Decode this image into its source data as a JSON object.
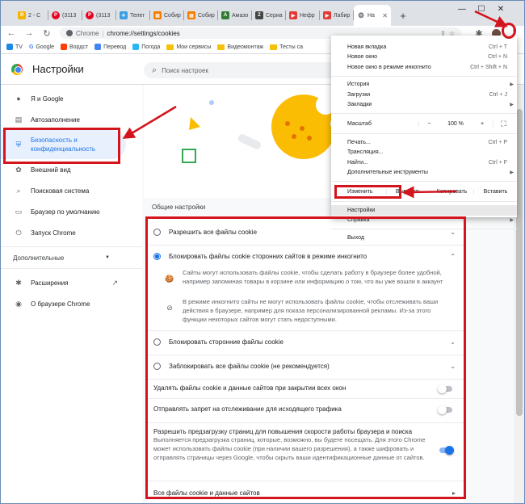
{
  "tabs": [
    {
      "label": "2 - С",
      "color": "#f4b400",
      "glyph": "Я"
    },
    {
      "label": "(3113",
      "color": "#e60023",
      "glyph": "P"
    },
    {
      "label": "(3113",
      "color": "#e60023",
      "glyph": "P"
    },
    {
      "label": "Телег",
      "color": "#3d9ee0",
      "glyph": "✈"
    },
    {
      "label": "Собир",
      "color": "#f57c00",
      "glyph": "▤"
    },
    {
      "label": "Собир",
      "color": "#f57c00",
      "glyph": "▤"
    },
    {
      "label": "Амазо",
      "color": "#2e7d32",
      "glyph": "A"
    },
    {
      "label": "Сериа",
      "color": "#444",
      "glyph": "Z"
    },
    {
      "label": "Нефр",
      "color": "#e53935",
      "glyph": "▶"
    },
    {
      "label": "Лабир",
      "color": "#e53935",
      "glyph": "▶"
    },
    {
      "label": "На",
      "color": "#5f6368",
      "glyph": "⚙"
    }
  ],
  "address": {
    "site": "Chrome",
    "url": "chrome://settings/cookies"
  },
  "bookmarks": [
    "TV",
    "Google",
    "Вордст",
    "Перевод",
    "Погода",
    "Мои сервисы",
    "Видеомонтаж",
    "Тесты са"
  ],
  "header": {
    "title": "Настройки",
    "search_placeholder": "Поиск настроек"
  },
  "sidebar": {
    "items": [
      {
        "label": "Я и Google",
        "icon": "person-icon",
        "glyph": "👤"
      },
      {
        "label": "Автозаполнение",
        "icon": "document-icon",
        "glyph": "▤"
      },
      {
        "label": "Безопасность и конфиденциальность",
        "icon": "shield-icon",
        "glyph": "⛨"
      },
      {
        "label": "Внешний вид",
        "icon": "palette-icon",
        "glyph": "🎨"
      },
      {
        "label": "Поисковая система",
        "icon": "search-icon",
        "glyph": "⌕"
      },
      {
        "label": "Браузер по умолчанию",
        "icon": "browser-icon",
        "glyph": "▭"
      },
      {
        "label": "Запуск Chrome",
        "icon": "power-icon",
        "glyph": "⏻"
      }
    ],
    "advanced": "Дополнительные",
    "extensions": "Расширения",
    "about": "О браузере Chrome"
  },
  "main": {
    "section_title": "Общие настройки",
    "options": [
      "Разрешить все файлы cookie",
      "Блокировать файлы cookie сторонних сайтов в режиме инкогнито",
      "Блокировать сторонние файлы cookie",
      "Заблокировать все файлы cookie (не рекомендуется)"
    ],
    "desc1": "Сайты могут использовать файлы cookie, чтобы сделать работу в браузере более удобной, например запоминая товары в корзине или информацию о том, что вы уже вошли в аккаунт",
    "desc2": "В режиме инкогнито сайты не могут использовать файлы cookie, чтобы отслеживать ваши действия в браузере, например для показа персонализированной рекламы. Из-за этого функции некоторых сайтов могут стать недоступными.",
    "toggle1": "Удалять файлы cookie и данные сайтов при закрытии всех окон",
    "toggle2": "Отправлять запрет на отслеживание для исходящего трафика",
    "toggle3_title": "Разрешить предзагрузку страниц для повышения скорости работы браузера и поиска",
    "toggle3_desc": "Выполняется предзагрузка страниц, которые, возможно, вы будете посещать. Для этого Chrome может использовать файлы cookie (при наличии вашего разрешения), а также шифровать и отправлять страницы через Google, чтобы скрыть ваши идентификационные данные от сайтов.",
    "all_cookies": "Все файлы cookie и данные сайтов"
  },
  "menu": {
    "items1": [
      {
        "label": "Новая вкладка",
        "sc": "Ctrl + T"
      },
      {
        "label": "Новое окно",
        "sc": "Ctrl + N"
      },
      {
        "label": "Новое окно в режиме инкогнито",
        "sc": "Ctrl + Shift + N"
      }
    ],
    "items2": [
      {
        "label": "История",
        "sc": ""
      },
      {
        "label": "Загрузки",
        "sc": "Ctrl + J"
      },
      {
        "label": "Закладки",
        "sc": ""
      }
    ],
    "zoom_label": "Масштаб",
    "zoom_minus": "−",
    "zoom_value": "100 %",
    "zoom_plus": "+",
    "items3": [
      {
        "label": "Печать...",
        "sc": "Ctrl + P"
      },
      {
        "label": "Трансляция...",
        "sc": ""
      },
      {
        "label": "Найти...",
        "sc": "Ctrl + F"
      },
      {
        "label": "Дополнительные инструменты",
        "sc": ""
      }
    ],
    "edit": "Изменить",
    "cut": "Вырезать",
    "copy": "Копировать",
    "paste": "Вставить",
    "settings": "Настройки",
    "help": "Справка",
    "exit": "Выход"
  },
  "colors": {
    "accent": "#1a73e8",
    "annotation": "#d4141d"
  }
}
